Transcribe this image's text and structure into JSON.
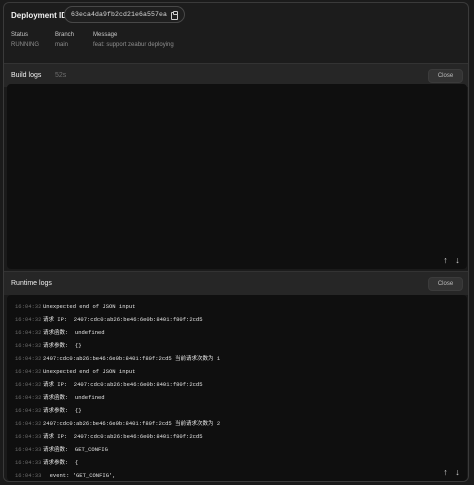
{
  "header": {
    "deployment_label": "Deployment ID:",
    "deployment_id": "63eca4da9fb2cd21e6a557ea"
  },
  "meta": {
    "status": {
      "label": "Status",
      "value": "RUNNING"
    },
    "branch": {
      "label": "Branch",
      "value": "main"
    },
    "message": {
      "label": "Message",
      "value": "feat: support zeabur deploying"
    }
  },
  "build_logs": {
    "title": "Build logs",
    "duration": "52s",
    "close_label": "Close",
    "lines": []
  },
  "runtime_logs": {
    "title": "Runtime logs",
    "close_label": "Close",
    "lines": [
      {
        "time": "16:04:32",
        "msg": "Unexpected end of JSON input"
      },
      {
        "time": "16:04:32",
        "msg": "请求 IP:  2407:cdc0:ab26:be46:6e0b:8401:f80f:2cd5"
      },
      {
        "time": "16:04:32",
        "msg": "请求函数:  undefined"
      },
      {
        "time": "16:04:32",
        "msg": "请求参数:  {}"
      },
      {
        "time": "16:04:32",
        "msg": "2407:cdc0:ab26:be46:6e0b:8401:f80f:2cd5 当前请求次数为 1"
      },
      {
        "time": "16:04:32",
        "msg": "Unexpected end of JSON input"
      },
      {
        "time": "16:04:32",
        "msg": "请求 IP:  2407:cdc0:ab26:be46:6e0b:8401:f80f:2cd5"
      },
      {
        "time": "16:04:32",
        "msg": "请求函数:  undefined"
      },
      {
        "time": "16:04:32",
        "msg": "请求参数:  {}"
      },
      {
        "time": "16:04:32",
        "msg": "2407:cdc0:ab26:be46:6e0b:8401:f80f:2cd5 当前请求次数为 2"
      },
      {
        "time": "16:04:33",
        "msg": "请求 IP:  2407:cdc0:ab26:be46:6e0b:8401:f80f:2cd5"
      },
      {
        "time": "16:04:33",
        "msg": "请求函数:  GET_CONFIG"
      },
      {
        "time": "16:04:33",
        "msg": "请求参数:  {"
      },
      {
        "time": "16:04:33",
        "msg": "  event: 'GET_CONFIG',"
      }
    ]
  },
  "icons": {
    "copy": "copy-icon",
    "up": "↑",
    "down": "↓"
  }
}
